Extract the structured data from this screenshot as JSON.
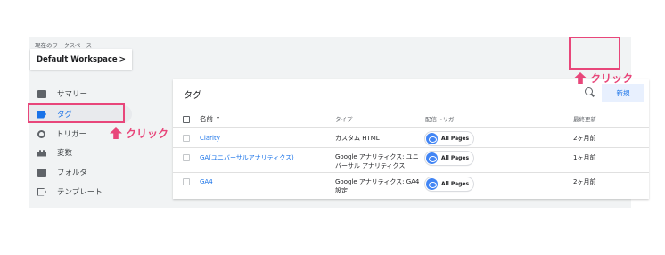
{
  "sidebar": {
    "workspace_label": "現在のワークスペース",
    "workspace_name": "Default Workspace",
    "workspace_chevron": ">",
    "items": [
      {
        "label": "サマリー",
        "icon": "folder-icon"
      },
      {
        "label": "タグ",
        "icon": "tag-icon",
        "active": true
      },
      {
        "label": "トリガー",
        "icon": "trigger-icon"
      },
      {
        "label": "変数",
        "icon": "variable-icon"
      },
      {
        "label": "フォルダ",
        "icon": "folder-icon"
      },
      {
        "label": "テンプレート",
        "icon": "template-icon"
      }
    ]
  },
  "main": {
    "title": "タグ",
    "new_button": "新規",
    "columns": {
      "name": "名前 ↑",
      "type": "タイプ",
      "trigger": "配信トリガー",
      "updated": "最終更新"
    },
    "rows": [
      {
        "name": "Clarity",
        "type": "カスタム HTML",
        "trigger": "All Pages",
        "updated": "2ヶ月前"
      },
      {
        "name": "GA(ユニバーサルアナリティクス)",
        "type": "Google アナリティクス: ユニバーサル アナリティクス",
        "trigger": "All Pages",
        "updated": "1ヶ月前"
      },
      {
        "name": "GA4",
        "type": "Google アナリティクス: GA4 設定",
        "trigger": "All Pages",
        "updated": "2ヶ月前"
      }
    ]
  },
  "annotations": {
    "click_text_1": "クリック",
    "click_text_2": "クリック",
    "highlight_color": "#e8467a"
  },
  "colors": {
    "accent": "#1a73e8",
    "background": "#f1f3f4"
  }
}
